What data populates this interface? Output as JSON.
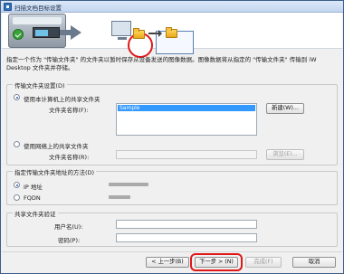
{
  "window": {
    "title": "扫描文档目标设置"
  },
  "description": "指定一个作为 \"传输文件夹\" 的文件夹以暂时保存从设备发送的图像数据。图像数据将从指定的 \"传输文件夹\" 传输到 iW Desktop 文件夹并存储。",
  "transfer_folder": {
    "group_title": "传输文件夹设置(D)",
    "local_option_label": "使用本计算机上的共享文件夹",
    "local_selected": true,
    "folder_name_label": "文件夹名称(F):",
    "folder_list": [
      "Sample"
    ],
    "new_button": "新建(W)...",
    "network_option_label": "使用网络上的共享文件夹",
    "network_folder_label": "文件夹名称(R):",
    "browse_button": "浏览(E)..."
  },
  "specify_method": {
    "group_title": "指定传输文件夹地址的方法(D)",
    "ip_option_label": "IP 地址",
    "ip_selected": true,
    "fqdn_option_label": "FQDN"
  },
  "auth": {
    "group_title": "共享文件夹验证",
    "username_label": "用户名(U):",
    "password_label": "密码(P):",
    "username_value": "",
    "password_value": ""
  },
  "footer": {
    "back_button": "< 上一步(B)",
    "next_button": "下一步 > (N)",
    "finish_button": "完成(F)",
    "cancel_button": "取消"
  },
  "colors": {
    "highlight": "#e01717",
    "selection": "#3399ff"
  },
  "icons": [
    "scanner-icon",
    "arrow-icon",
    "computer-icon",
    "folder-icon",
    "folder-icon"
  ]
}
